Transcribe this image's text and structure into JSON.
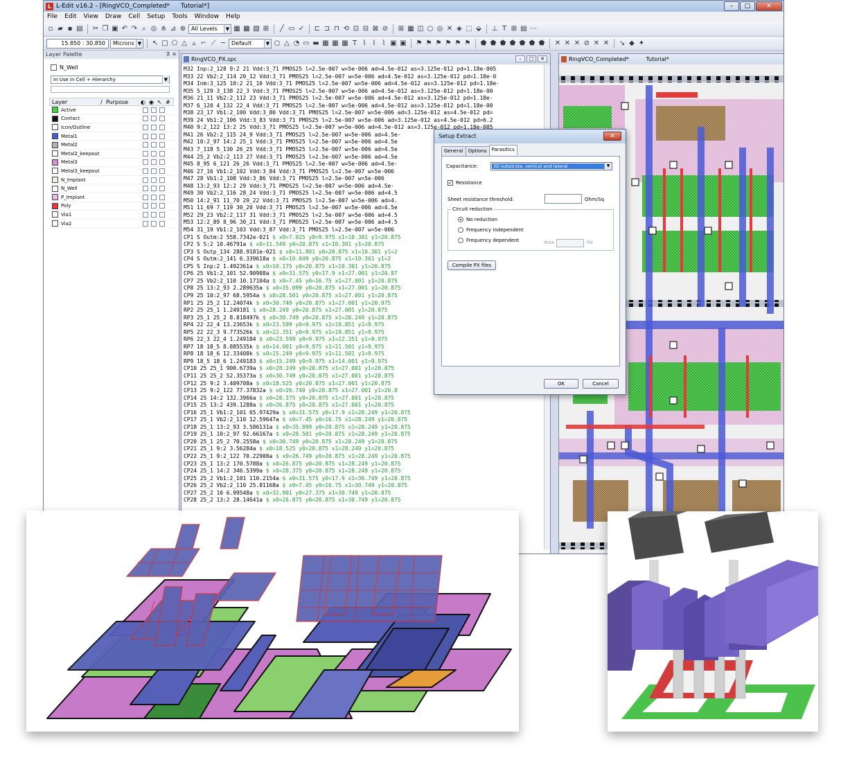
{
  "window": {
    "app_label": "L",
    "title": "L-Edit v16.2 - [RingVCO_Completed*",
    "title_tab": "Tutorial*]",
    "buttons": [
      "–",
      "□",
      "✕"
    ]
  },
  "menu": [
    "File",
    "Edit",
    "View",
    "Draw",
    "Cell",
    "Setup",
    "Tools",
    "Window",
    "Help"
  ],
  "toolbar": {
    "levels_select": "All Levels",
    "coords": "15.850 : 30.850",
    "units_select": "Microns",
    "style_select": "Default"
  },
  "layer_palette": {
    "title": "Layer Palette",
    "pin_close": "⊼ ✕",
    "current_layer": "N_Well",
    "filter_select": "In Use in Cell + Hierarchy",
    "col_layer": "Layer",
    "col_sort": "/",
    "col_purpose": "Purpose",
    "col_hash": "#",
    "layers": [
      {
        "name": "Active",
        "color": "#3cd83c"
      },
      {
        "name": "Contact",
        "color": "#111111"
      },
      {
        "name": "Icon/Outline",
        "color": "#ffffff"
      },
      {
        "name": "Metal1",
        "color": "#4a5ad8"
      },
      {
        "name": "Metal2",
        "color": "#b3b3b3"
      },
      {
        "name": "Metal2_keepout",
        "color": "#ffffff"
      },
      {
        "name": "Metal3",
        "color": "#d48fd4"
      },
      {
        "name": "Metal3_keepout",
        "color": "#ffffff"
      },
      {
        "name": "N_Implant",
        "color": "#e8f4e0"
      },
      {
        "name": "N_Well",
        "color": "#ffffff"
      },
      {
        "name": "P_Implant",
        "color": "#f2b8e4"
      },
      {
        "name": "Poly",
        "color": "#e63a3a"
      },
      {
        "name": "Via1",
        "color": "#ffffff"
      },
      {
        "name": "Via2",
        "color": "#ffffff"
      }
    ]
  },
  "spice_window": {
    "title": "RingVCO_PX.spc",
    "buttons": [
      "–",
      "□",
      "✕"
    ],
    "lines": [
      {
        "code": "M32 Inp:2_128 9:2 21 Vdd:3_71 PMOS25 l=2.5e-007 w=5e-006 ad=4.5e-012 as=3.125e-012 pd=1.18e-005",
        "comment": ""
      },
      {
        "code": "M33 22 Vb2:2_114 20_12 Vdd:3_71 PMOS25 l=2.5e-007 w=5e-006 ad=4.5e-012 as=3.125e-012 pd=1.18e-0",
        "comment": ""
      },
      {
        "code": "M34 Inm:3_125 10:2 21_10 Vdd:3_71 PMOS25 l=2.5e-007 w=5e-006 ad=4.5e-012 as=3.125e-012 pd=1.18e-",
        "comment": ""
      },
      {
        "code": "M35 5_129 3_138 22_3 Vdd:3_71 PMOS25 l=2.5e-007 w=5e-006 ad=4.5e-012 as=3.125e-012 pd=1.18e-00",
        "comment": ""
      },
      {
        "code": "M36 21_11 Vb2:2_112 23 Vdd:3_71 PMOS25 l=2.5e-007 w=5e-006 ad=4.5e-012 as=3.125e-012 pd=1.18e-",
        "comment": ""
      },
      {
        "code": "M37 6_120 4_132 22_4 Vdd:3_71 PMOS25 l=2.5e-007 w=5e-006 ad=4.5e-012 as=3.125e-012 pd=1.18e-00",
        "comment": ""
      },
      {
        "code": "M38 23_17 Vb1:2_100 Vdd:3_80 Vdd:3_71 PMOS25 l=2.5e-007 w=5e-006 ad=3.125e-012 as=4.5e-012 pd=",
        "comment": ""
      },
      {
        "code": "M39 24 Vb1:2_106 Vdd:3_83 Vdd:3_71 PMOS25 l=2.5e-007 w=5e-006 ad=3.125e-012 as=4.5e-012 pd=6.2",
        "comment": ""
      },
      {
        "code": "M40 9:2_122 13:2 25 Vdd:3_71 PMOS25 l=2.5e-007 w=5e-006 ad=4.5e-012 as=3.125e-012 pd=1.18e-005",
        "comment": ""
      },
      {
        "code": "M41 26 Vb2:2_115 24_9 Vdd:3_71 PMOS25 l=2.5e-007 w=5e-006 ad=4.5e-",
        "comment": ""
      },
      {
        "code": "M42 10:2_97 14:2 25_1 Vdd:3_71 PMOS25 l=2.5e-007 w=5e-006 ad=4.5e",
        "comment": ""
      },
      {
        "code": "M43 7_118 5_130 26_25 Vdd:3_71 PMOS25 l=2.5e-007 w=5e-006 ad=4.5e",
        "comment": ""
      },
      {
        "code": "M44 25_2 Vb2:2_113 27 Vdd:3_71 PMOS25 l=2.5e-007 w=5e-006 ad=4.5e",
        "comment": ""
      },
      {
        "code": "M45 8_95 6_121 26_26 Vdd:3_71 PMOS25 l=2.5e-007 w=5e-006 ad=4.5e-",
        "comment": ""
      },
      {
        "code": "M46 27_16 Vb1:2_102 Vdd:3_84 Vdd:3_71 PMOS25 l=2.5e-007 w=5e-006",
        "comment": ""
      },
      {
        "code": "M47 28 Vb1:2_108 Vdd:3_86 Vdd:3_71 PMOS25 l=2.5e-007 w=5e-006",
        "comment": ""
      },
      {
        "code": "M48 13:2_93 12:2 29 Vdd:3_71 PMOS25 l=2.5e-007 w=5e-006 ad=4.5e-",
        "comment": ""
      },
      {
        "code": "M49 30 Vb2:2_116 28_24 Vdd:3_71 PMOS25 l=2.5e-007 w=5e-006 ad=4.5",
        "comment": ""
      },
      {
        "code": "M50 14:2_91 11_70 29_22 Vdd:3_71 PMOS25 l=2.5e-007 w=5e-006 ad=4.",
        "comment": ""
      },
      {
        "code": "M51 11_69 7_119 30_20 Vdd:3_71 PMOS25 l=2.5e-007 w=5e-006 ad=4.5e",
        "comment": ""
      },
      {
        "code": "M52 29_23 Vb2:2_117 31 Vdd:3_71 PMOS25 l=2.5e-007 w=5e-006 ad=4.5",
        "comment": ""
      },
      {
        "code": "M53 12:2_89 8_96 30_21 Vdd:3_71 PMOS25 l=2.5e-007 w=5e-006 ad=4.5",
        "comment": ""
      },
      {
        "code": "M54 31_19 Vb1:2_103 Vdd:3_87 Vdd:3_71 PMOS25 l=2.5e-007 w=5e-006",
        "comment": ""
      },
      {
        "code": "CP1 S Outm:2 558.7342e-021 ",
        "comment": "$ x0=7.025 y0=9.975 x1=10.301 y1=20.875"
      },
      {
        "code": "CP2 S S:2 10.46791a ",
        "comment": "$ x0=11.549 y0=20.875 x1=10.301 y1=20.875"
      },
      {
        "code": "CP3 S Outp_134 288.9181e-021 ",
        "comment": "$ x0=11.801 y0=20.875 x1=10.301 y1=2"
      },
      {
        "code": "CP4 S Outm:2_141 6.339618a ",
        "comment": "$ x0=10.049 y0=20.875 x1=10.301 y1=2"
      },
      {
        "code": "CP5 S Inp:2 1.492361a ",
        "comment": "$ x0=10.175 y0=20.875 x1=10.301 y1=20.875"
      },
      {
        "code": "CP6 25 Vb1:2_101 52.90908a ",
        "comment": "$ x0=31.575 y0=17.9 x1=27.001 y1=20.87"
      },
      {
        "code": "CP7 25 Vb2:2_110 10.17104a ",
        "comment": "$ x0=7.45 y0=16.75 x1=27.001 y1=20.875"
      },
      {
        "code": "CP8 25 13:2_93 2.289635a ",
        "comment": "$ x0=35.099 y0=20.875 x1=27.001 y1=20.875"
      },
      {
        "code": "CP9 25 10:2_97 68.5954a ",
        "comment": "$ x0=28.501 y0=20.875 x1=27.001 y1=20.875"
      },
      {
        "code": "RP1 25 25_2 12.24074k ",
        "comment": "$ x0=30.749 y0=20.875 x1=27.001 y1=20.875"
      },
      {
        "code": "RP2 25 25_1 1.249181 ",
        "comment": "$ x0=28.249 y0=20.875 x1=27.001 y1=20.875"
      },
      {
        "code": "RP3 25_1 25_2 8.818497k ",
        "comment": "$ x0=30.749 y0=20.875 x1=28.249 y1=20.875"
      },
      {
        "code": "RP4 22 22_4 13.23653k ",
        "comment": "$ x0=23.599 y0=9.975 x1=19.851 y1=9.975"
      },
      {
        "code": "RP5 22 22_3 9.773526k ",
        "comment": "$ x0=22.351 y0=9.975 x1=19.851 y1=9.975"
      },
      {
        "code": "RP6 22_3 22_4 1.249184 ",
        "comment": "$ x0=23.599 y0=9.975 x1=22.351 y1=9.975"
      },
      {
        "code": "RP7 18 18_5 8.885535k ",
        "comment": "$ x0=14.001 y0=9.975 x1=11.501 y1=9.975"
      },
      {
        "code": "RP8 18 18_6 12.33408k ",
        "comment": "$ x0=15.249 y0=9.975 x1=11.501 y1=9.975"
      },
      {
        "code": "RP9 18_5 18_6 1.249183 ",
        "comment": "$ x0=15.249 y0=9.975 x1=14.001 y1=9.975"
      },
      {
        "code": "CP10 25 25_1 900.6739a ",
        "comment": "$ x0=28.249 y0=20.875 x1=27.001 y1=20.875"
      },
      {
        "code": "CP11 25 25_2 52.35373a ",
        "comment": "$ x0=30.749 y0=20.875 x1=27.001 y1=20.875"
      },
      {
        "code": "CP12 25 9:2 3.409708a ",
        "comment": "$ x0=18.525 y0=20.875 x1=27.001 y1=20.875"
      },
      {
        "code": "CP13 25 9:2_122 77.37832a ",
        "comment": "$ x0=26.749 y0=20.875 x1=27.001 y1=20.8"
      },
      {
        "code": "CP14 25 14:2 132.3966a ",
        "comment": "$ x0=28.375 y0=20.875 x1=27.001 y1=20.875"
      },
      {
        "code": "CP15 25 13:2 439.1288a ",
        "comment": "$ x0=26.875 y0=20.875 x1=27.001 y1=20.875"
      },
      {
        "code": "CP16 25_1 Vb1:2_101 65.97429a ",
        "comment": "$ x0=31.575 y0=17.9 x1=28.249 y1=20.875"
      },
      {
        "code": "CP17 25_1 Vb2:2_110 12.59647a ",
        "comment": "$ x0=7.45 y0=16.75 x1=28.249 y1=20.875"
      },
      {
        "code": "CP18 25_1 13:2_93 3.586131a ",
        "comment": "$ x0=35.099 y0=20.875 x1=28.249 y1=20.875"
      },
      {
        "code": "CP19 25_1 10:2_97 92.66167a ",
        "comment": "$ x0=28.501 y0=20.875 x1=28.249 y1=20.875"
      },
      {
        "code": "CP20 25_1 25_2 70.2558a ",
        "comment": "$ x0=30.749 y0=20.875 x1=28.249 y1=20.875"
      },
      {
        "code": "CP21 25_1 9:2 3.56284a ",
        "comment": "$ x0=18.525 y0=20.875 x1=28.249 y1=20.875"
      },
      {
        "code": "CP22 25_1 9:2_122 70.22908a ",
        "comment": "$ x0=26.749 y0=20.875 x1=28.249 y1=20.875"
      },
      {
        "code": "CP23 25_1 13:2 170.5788a ",
        "comment": "$ x0=26.875 y0=20.875 x1=28.249 y1=20.875"
      },
      {
        "code": "CP24 25_1 14:2 346.5399a ",
        "comment": "$ x0=28.375 y0=20.875 x1=28.249 y1=20.875"
      },
      {
        "code": "CP25 25_2 Vb1:2_101 110.2154a ",
        "comment": "$ x0=31.575 y0=17.9 x1=30.749 y1=20.875"
      },
      {
        "code": "CP26 25_2 Vb2:2_110 25.81168a ",
        "comment": "$ x0=7.45 y0=16.75 x1=30.749 y1=20.875"
      },
      {
        "code": "CP27 25_2 10 6.99548a ",
        "comment": "$ x0=32.901 y0=27.375 x1=30.749 y1=20.875"
      },
      {
        "code": "CP28 25_2 13:2 28.14641a ",
        "comment": "$ x0=26.875 y0=20.875 x1=30.749 y1=20.875"
      }
    ]
  },
  "layout_window": {
    "title": "RingVCO_Completed*",
    "title_tab": "Tutorial*"
  },
  "dialog": {
    "title": "Setup Extract",
    "close": "✕",
    "tabs": [
      "General",
      "Options",
      "Parasitics"
    ],
    "active_tab": "Parasitics",
    "capacitance_label": "Capacitance:",
    "capacitance_value": "3D substrate, vertical and lateral",
    "resistance_label": "Resistance",
    "resistance_checked": "✓",
    "sheet_label": "Sheet resistance threshold:",
    "sheet_unit": "Ohm/Sq",
    "reduction_legend": "Circuit reduction",
    "reduction_options": [
      "No reduction",
      "Frequency independent",
      "Frequency dependent"
    ],
    "max_label": "max",
    "hz_label": "Hz",
    "compile_button": "Compile PX files",
    "ok_button": "OK",
    "cancel_button": "Cancel"
  }
}
